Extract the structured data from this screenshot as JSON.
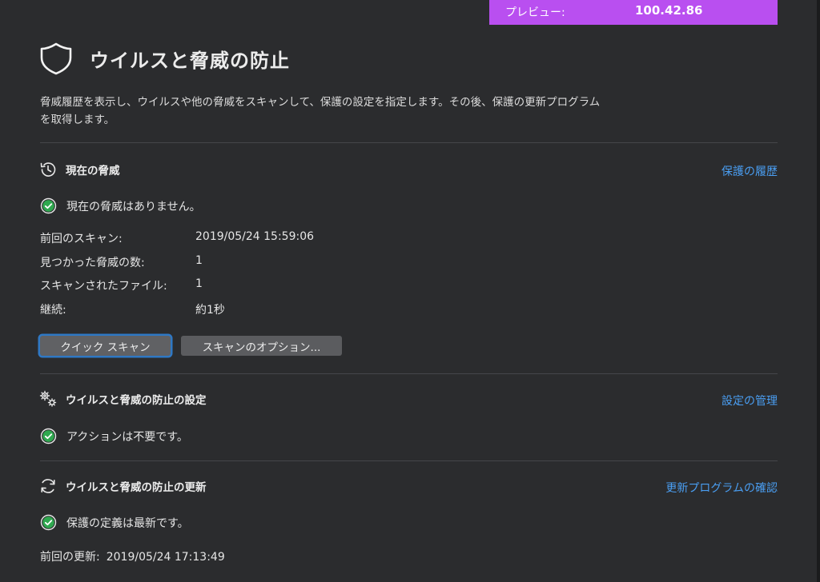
{
  "preview": {
    "label": "プレビュー:",
    "value": "100.42.86"
  },
  "header": {
    "title": "ウイルスと脅威の防止",
    "description": "脅威履歴を表示し、ウイルスや他の脅威をスキャンして、保護の設定を指定します。その後、保護の更新プログラムを取得します。"
  },
  "current_threats": {
    "title": "現在の脅威",
    "link": "保護の履歴",
    "status": "現在の脅威はありません。",
    "details": [
      {
        "label": "前回のスキャン:",
        "value": "2019/05/24 15:59:06"
      },
      {
        "label": "見つかった脅威の数:",
        "value": "1"
      },
      {
        "label": "スキャンされたファイル:",
        "value": "1"
      },
      {
        "label": "継続:",
        "value": "約1秒"
      }
    ],
    "quick_scan_label": "クイック スキャン",
    "scan_options_label": "スキャンのオプション..."
  },
  "settings": {
    "title": "ウイルスと脅威の防止の設定",
    "link": "設定の管理",
    "status": "アクションは不要です。"
  },
  "updates": {
    "title": "ウイルスと脅威の防止の更新",
    "link": "更新プログラムの確認",
    "status": "保護の定義は最新です。",
    "last_update_label": "前回の更新:",
    "last_update_value": "2019/05/24 17:13:49"
  },
  "colors": {
    "background": "#2b2c2e",
    "banner": "#b94ff0",
    "link": "#4a9ef2",
    "success": "#2fa84f",
    "button": "#5b5c5f",
    "focus": "#2f78c4"
  }
}
